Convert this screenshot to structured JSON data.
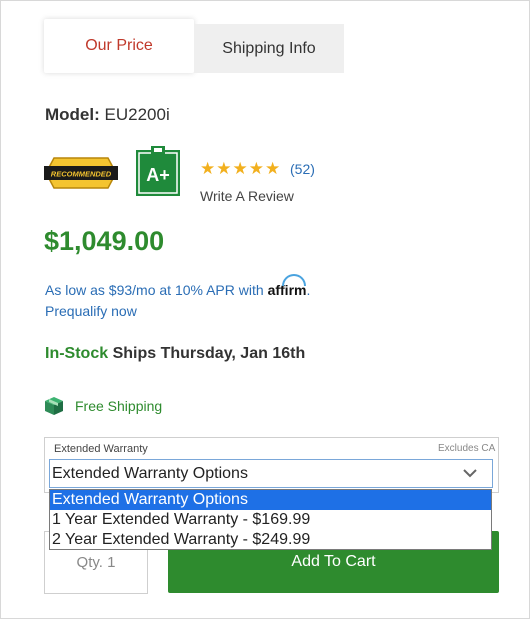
{
  "tabs": [
    {
      "label": "Our Price"
    },
    {
      "label": "Shipping Info"
    }
  ],
  "product": {
    "model_label": "Model:",
    "model_value": "EU2200i",
    "badge_recommended": "RECOMMENDED",
    "badge_grade": "A+",
    "rating": 5,
    "review_count": "(52)",
    "write_review": "Write A Review",
    "price": "$1,049.00"
  },
  "financing": {
    "text": "As low as $93/mo at 10% APR with",
    "brand": "affirm",
    "suffix": ".",
    "prequalify": "Prequalify now"
  },
  "stock": {
    "status": "In-Stock",
    "ships": "Ships Thursday, Jan 16th"
  },
  "shipping": {
    "label": "Free Shipping"
  },
  "warranty": {
    "label": "Extended Warranty",
    "excludes": "Excludes CA",
    "selected": "Extended Warranty Options",
    "options": [
      "Extended Warranty Options",
      "1 Year Extended Warranty - $169.99",
      "2 Year Extended Warranty - $249.99"
    ]
  },
  "cart": {
    "qty_placeholder": "Qty. 1",
    "add_label": "Add To Cart"
  },
  "colors": {
    "accent_red": "#c0392b",
    "green": "#2e8b2e",
    "link_blue": "#2a6db5",
    "star": "#f2b01e",
    "selected_option": "#1e70e6"
  }
}
